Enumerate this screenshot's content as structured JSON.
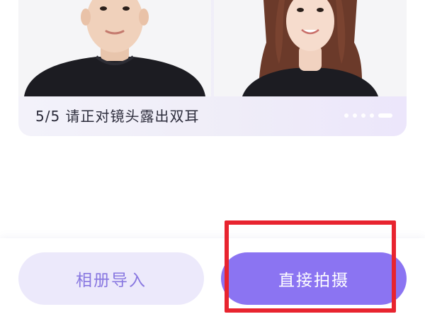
{
  "example": {
    "caption": "5/5 请正对镜头露出双耳",
    "pager": {
      "total": 5,
      "current": 5
    }
  },
  "actions": {
    "album_label": "相册导入",
    "capture_label": "直接拍摄"
  },
  "colors": {
    "accent": "#8b74f2",
    "accent_light": "#ece9fb",
    "accent_text": "#8877e0",
    "highlight": "#e8242f"
  },
  "icons": [
    "example-photo-male",
    "example-photo-female"
  ]
}
